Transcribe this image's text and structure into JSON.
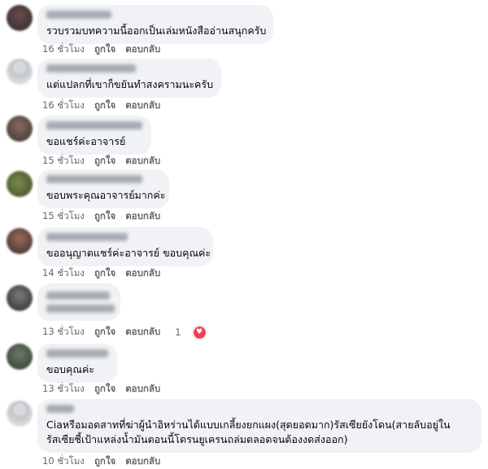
{
  "actions": {
    "like": "ถูกใจ",
    "reply": "ตอบกลับ"
  },
  "comments": [
    {
      "text": "รวบรวมบทความนี้ออกเป็นเล่มหนังสืออ่านสนุกครับ",
      "time": "16 ชั่วโมง"
    },
    {
      "text": "แต่แปลกที่เขาก็ขยันทำสงครามนะครับ",
      "time": "16 ชั่วโมง"
    },
    {
      "text": "ขอแชร์ค่ะอาจารย์",
      "time": "15 ชั่วโมง"
    },
    {
      "text": "ขอบพระคุณอาจารย์มากค่ะ",
      "time": "15 ชั่วโมง"
    },
    {
      "text": "ขออนุญาตแชร์ค่ะอาจารย์ ขอบคุณค่ะ",
      "time": "14 ชั่วโมง"
    },
    {
      "text": "",
      "time": "13 ชั่วโมง",
      "reaction_count": "1"
    },
    {
      "text": "ขอบคุณค่ะ",
      "time": "13 ชั่วโมง"
    },
    {
      "text": "Ciaหรือมอดสาทที่ฆ่าผู้นำอิหร่านได้แบบเกลี้ยงยกแผง(สุดยอดมาก)รัสเซียยังโดน(สายลับอยู่ในรัสเซียชี้เป้าแหล่งน้ำมันตอนนี้โดรนยูเครนถล่มตลอดจนต้องงดส่งออก)",
      "time": "10 ชั่วโมง"
    }
  ],
  "colors": {
    "bubble": "#f0f2f5",
    "meta": "#65676b",
    "heart": "#f33e58"
  },
  "icons": {
    "reaction": "heart-icon"
  }
}
